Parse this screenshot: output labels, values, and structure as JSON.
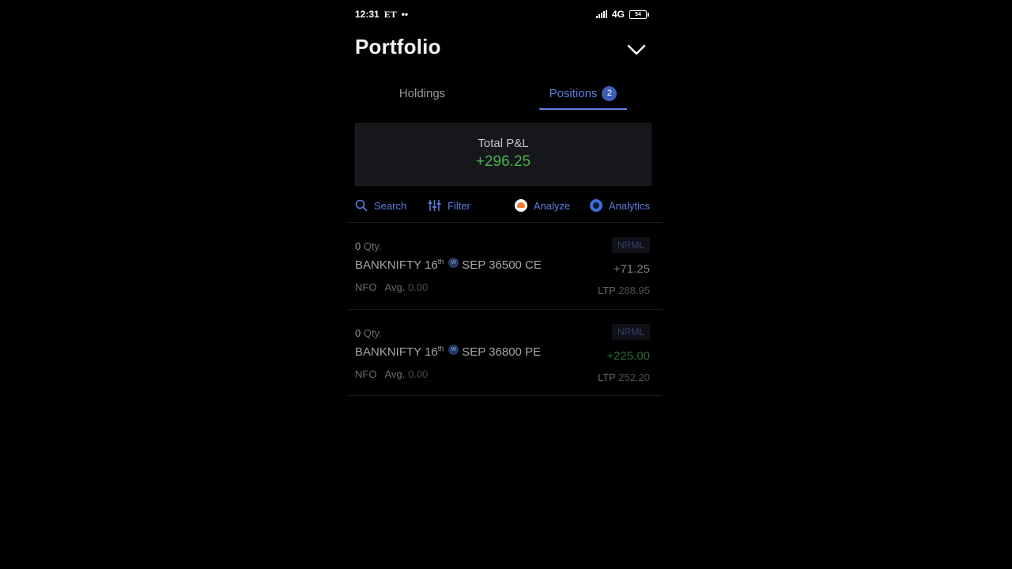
{
  "status_bar": {
    "time": "12:31",
    "carrier": "ET",
    "dots": "••",
    "network": "4G",
    "battery": "54"
  },
  "header": {
    "title": "Portfolio"
  },
  "tabs": [
    {
      "label": "Holdings",
      "active": false
    },
    {
      "label": "Positions",
      "active": true,
      "badge": "2"
    }
  ],
  "summary": {
    "label": "Total P&L",
    "value": "+296.25"
  },
  "toolbar": {
    "search_label": "Search",
    "filter_label": "Filter",
    "analyze_label": "Analyze",
    "analytics_label": "Analytics"
  },
  "positions": [
    {
      "qty": "0",
      "qty_label": "Qty.",
      "symbol": "BANKNIFTY 16",
      "date_suffix": "th",
      "weekly_badge": "W",
      "contract": "SEP 36500 CE",
      "exchange": "NFO",
      "avg_label": "Avg.",
      "avg_value": "0.00",
      "product": "NRML",
      "pnl": "+71.25",
      "ltp_label": "LTP",
      "ltp_value": "288.95"
    },
    {
      "qty": "0",
      "qty_label": "Qty.",
      "symbol": "BANKNIFTY 16",
      "date_suffix": "th",
      "weekly_badge": "W",
      "contract": "SEP 36800 PE",
      "exchange": "NFO",
      "avg_label": "Avg.",
      "avg_value": "0.00",
      "product": "NRML",
      "pnl": "+225.00",
      "ltp_label": "LTP",
      "ltp_value": "252.20"
    }
  ],
  "colors": {
    "accent": "#5d7fe0",
    "profit": "#4caf50",
    "background": "#000000",
    "card": "#15171b"
  }
}
